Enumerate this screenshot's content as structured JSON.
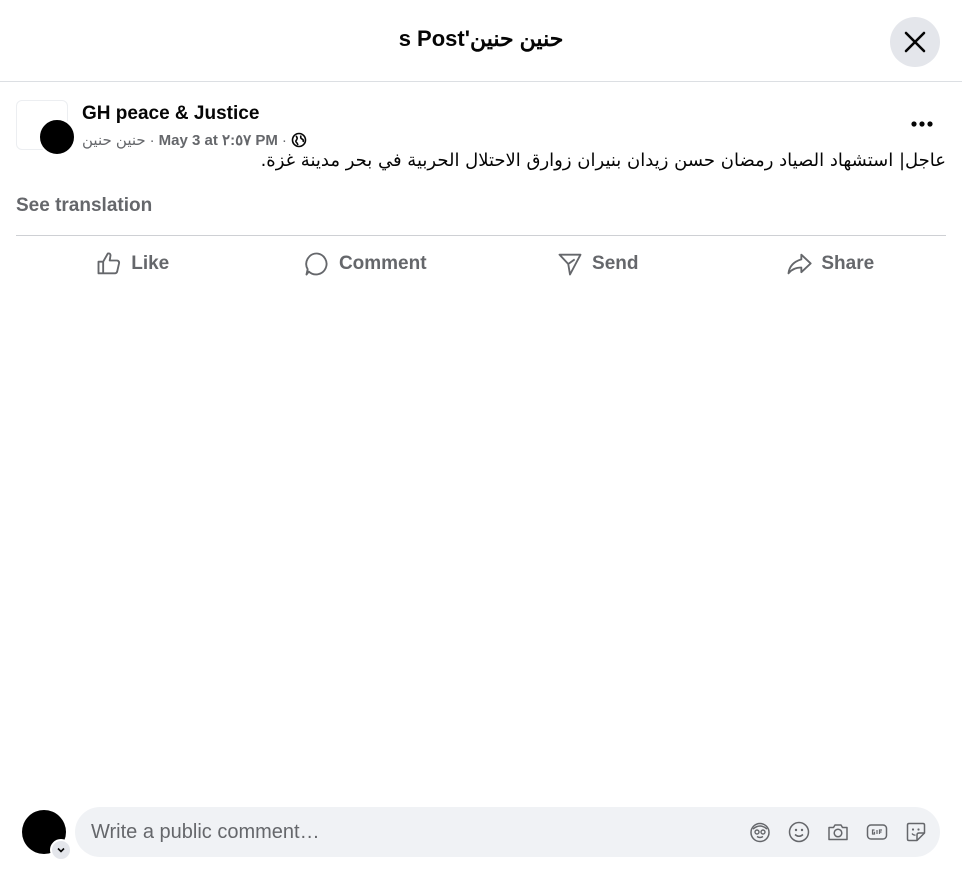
{
  "dialog": {
    "title": "حنين حنين's Post",
    "close_icon": "close-icon"
  },
  "post": {
    "page_name": "GH peace & Justice",
    "author": "حنين حنين",
    "date": "May 3 at ٢:٥٧ PM",
    "separator": "·",
    "audience_icon": "globe-icon",
    "more_icon": "more-icon",
    "text": "عاجل| استشهاد الصياد رمضان حسن زيدان بنيران زوارق الاحتلال الحربية في بحر مدينة غزة.",
    "see_translation": "See translation"
  },
  "actions": {
    "like": "Like",
    "comment": "Comment",
    "send": "Send",
    "share": "Share"
  },
  "comment_bar": {
    "placeholder": "Write a public comment…",
    "icons": [
      "avatar-sticker-icon",
      "emoji-icon",
      "camera-icon",
      "gif-icon",
      "sticker-icon"
    ]
  }
}
